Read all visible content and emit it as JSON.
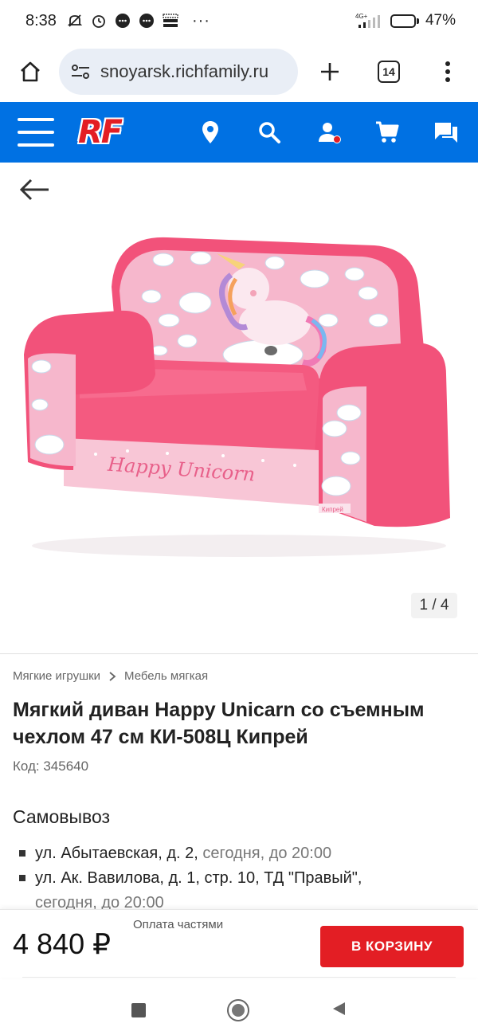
{
  "status_bar": {
    "time": "8:38",
    "network": "4G+",
    "battery": "47%",
    "battery_level": 0.47,
    "more": "···"
  },
  "browser": {
    "url": "snoyarsk.richfamily.ru",
    "tabs_count": "14"
  },
  "site_header": {
    "logo": "RF"
  },
  "product": {
    "image_counter": "1 / 4",
    "image_current": 1,
    "image_total": 4,
    "breadcrumbs": [
      "Мягкие игрушки",
      "Мебель мягкая"
    ],
    "title": "Мягкий диван Happy Unicarn со съемным чехлом 47 см КИ-508Ц Кипрей",
    "code": "Код: 345640",
    "sofa_print_text": "Happy Unicorn",
    "sofa_tag_text": "Кипрей"
  },
  "pickup": {
    "title": "Самовывоз",
    "items": [
      {
        "address": "ул. Абытаевская, д. 2, ",
        "time": "сегодня, до 20:00"
      },
      {
        "address": "ул. Ак. Вавилова, д. 1, стр. 10, ТД \"Правый\",",
        "time": "сегодня, до 20:00"
      }
    ]
  },
  "buy_bar": {
    "installment": "Оплата частями",
    "price": "4 840 ₽",
    "cart_button": "В КОРЗИНУ"
  },
  "colors": {
    "brand_blue": "#0071e3",
    "brand_red": "#e31e24",
    "sofa_pink": "#f2527a",
    "sofa_light_pink": "#f6b7cc"
  }
}
